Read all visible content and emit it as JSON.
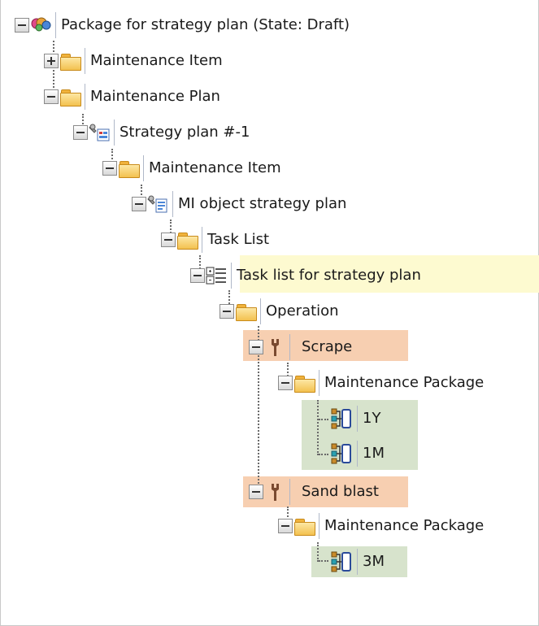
{
  "tree": {
    "root": {
      "label": "Package for strategy plan (State: Draft)",
      "icon": "package-icon"
    },
    "nodes": [
      {
        "id": "maint-item-top",
        "label": "Maintenance Item",
        "icon": "folder-icon",
        "expanded": false
      },
      {
        "id": "maint-plan",
        "label": "Maintenance Plan",
        "icon": "folder-icon",
        "expanded": true
      },
      {
        "id": "strategy-plan",
        "label": "Strategy plan #-1",
        "icon": "strategy-plan-icon",
        "expanded": true
      },
      {
        "id": "maint-item",
        "label": "Maintenance Item",
        "icon": "folder-icon",
        "expanded": true
      },
      {
        "id": "mi-object",
        "label": "MI object strategy plan",
        "icon": "maintenance-item-icon",
        "expanded": true
      },
      {
        "id": "task-list-folder",
        "label": "Task List",
        "icon": "folder-icon",
        "expanded": true
      },
      {
        "id": "task-list",
        "label": "Task list for strategy plan",
        "icon": "task-list-icon",
        "expanded": true
      },
      {
        "id": "operation",
        "label": "Operation",
        "icon": "folder-icon",
        "expanded": true
      },
      {
        "id": "scrape",
        "label": "Scrape",
        "icon": "wrench-icon",
        "expanded": true
      },
      {
        "id": "mpkg-1",
        "label": "Maintenance Package",
        "icon": "folder-icon",
        "expanded": true
      },
      {
        "id": "pkg-1y",
        "label": "1Y",
        "icon": "package-connector-icon"
      },
      {
        "id": "pkg-1m",
        "label": "1M",
        "icon": "package-connector-icon"
      },
      {
        "id": "sand-blast",
        "label": "Sand blast",
        "icon": "wrench-icon",
        "expanded": true
      },
      {
        "id": "mpkg-2",
        "label": "Maintenance Package",
        "icon": "folder-icon",
        "expanded": true
      },
      {
        "id": "pkg-3m",
        "label": "3M",
        "icon": "package-connector-icon"
      }
    ]
  },
  "colors": {
    "selected_highlight": "#fdfad0",
    "operation_highlight": "#f7cfb1",
    "package_highlight": "#d7e3cc"
  }
}
